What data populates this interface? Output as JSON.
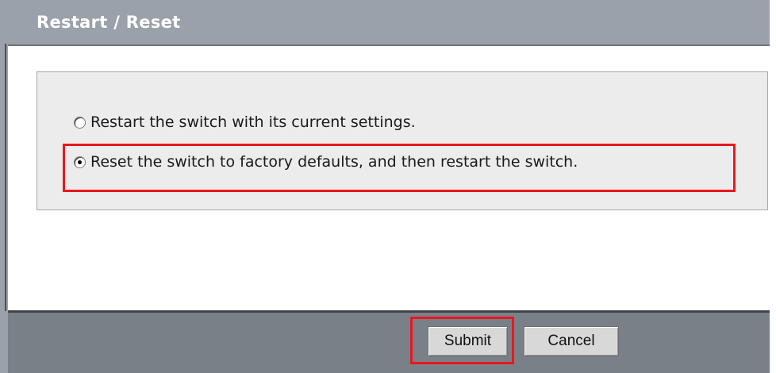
{
  "header": {
    "title": "Restart / Reset"
  },
  "options": [
    {
      "label": "Restart the switch with its current settings.",
      "selected": false
    },
    {
      "label": "Reset the switch to factory defaults, and then restart the switch.",
      "selected": true
    }
  ],
  "footer": {
    "submit_label": "Submit",
    "cancel_label": "Cancel"
  },
  "colors": {
    "header_bg": "#9aa1aa",
    "footer_bg": "#7a8088",
    "panel_bg": "#ececec",
    "highlight": "#e8181e"
  }
}
